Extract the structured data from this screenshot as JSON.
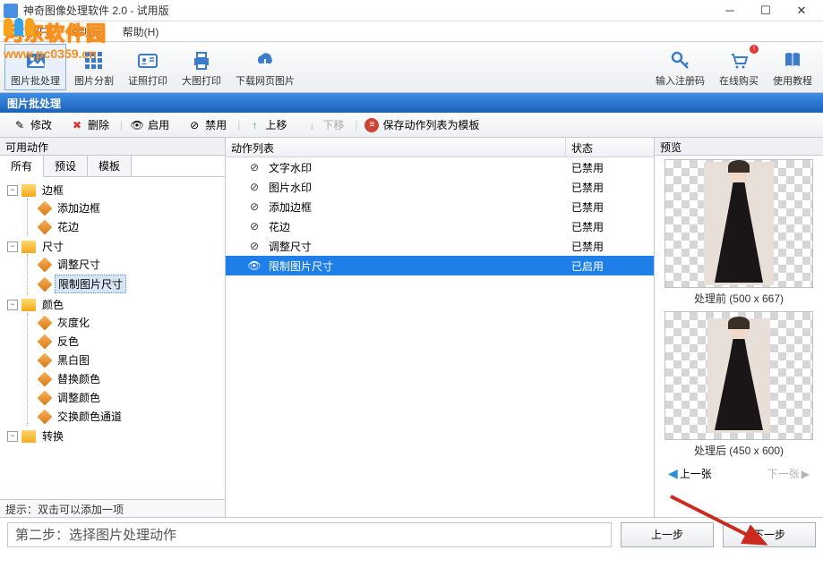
{
  "window": {
    "title": "神奇图像处理软件 2.0 - 试用版"
  },
  "watermark": {
    "text": "河东软件园",
    "url": "www.pc0359.cn"
  },
  "menu": {
    "file": "文件(F)",
    "goto": "转到(G)",
    "help": "帮助(H)"
  },
  "toolbar": {
    "batch": "图片批处理",
    "split": "图片分割",
    "idprint": "证照打印",
    "bigprint": "大图打印",
    "download": "下载网页图片",
    "regcode": "输入注册码",
    "buy": "在线购买",
    "tutorial": "使用教程"
  },
  "section": {
    "title": "图片批处理"
  },
  "actionbar": {
    "modify": "修改",
    "delete": "删除",
    "enable": "启用",
    "disable": "禁用",
    "moveup": "上移",
    "movedown": "下移",
    "savetpl": "保存动作列表为模板"
  },
  "leftpanel": {
    "title": "可用动作",
    "tabs": {
      "all": "所有",
      "preset": "预设",
      "template": "模板"
    },
    "hint": "提示：双击可以添加一项",
    "tree": {
      "border": "边框",
      "addborder": "添加边框",
      "lace": "花边",
      "size": "尺寸",
      "resize": "调整尺寸",
      "limitsize": "限制图片尺寸",
      "color": "颜色",
      "gray": "灰度化",
      "invert": "反色",
      "bw": "黑白图",
      "replace": "替换颜色",
      "huesat": "调整颜色",
      "swap": "交换颜色通道",
      "convert": "转换"
    }
  },
  "list": {
    "col_action": "动作列表",
    "col_status": "状态",
    "disabled": "已禁用",
    "enabled": "已启用",
    "rows": {
      "textwm": "文字水印",
      "imgwm": "图片水印",
      "addborder": "添加边框",
      "lace": "花边",
      "resize": "调整尺寸",
      "limitsize": "限制图片尺寸"
    }
  },
  "preview": {
    "title": "预览",
    "before": "处理前 (500 x 667)",
    "after": "处理后 (450 x 600)",
    "prev": "上一张",
    "next": "下一张"
  },
  "footer": {
    "step": "第二步：选择图片处理动作",
    "prev": "上一步",
    "next": "下一步"
  }
}
